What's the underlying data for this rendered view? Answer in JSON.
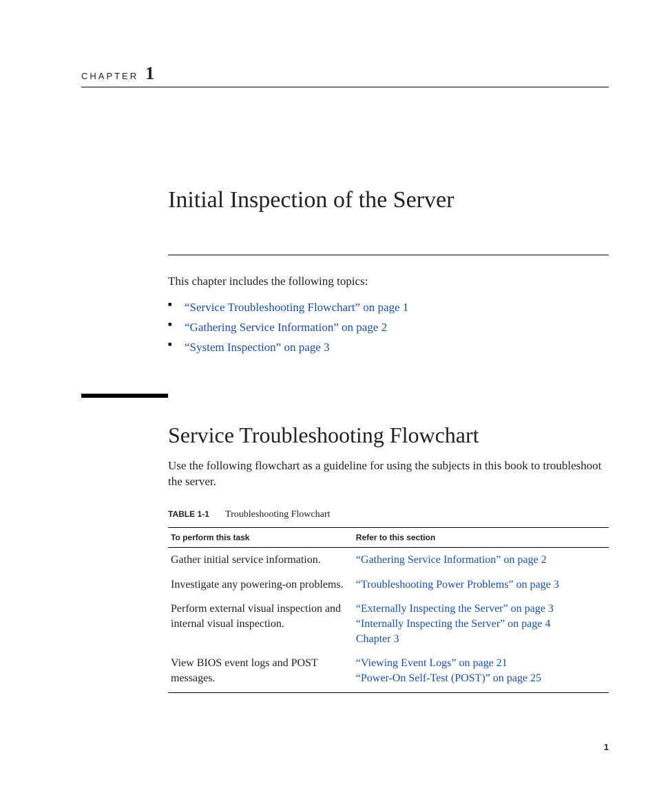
{
  "chapter": {
    "label": "CHAPTER",
    "number": "1"
  },
  "title": "Initial Inspection of the Server",
  "intro": "This chapter includes the following topics:",
  "toc": [
    "“Service Troubleshooting Flowchart” on page 1",
    "“Gathering Service Information” on page 2",
    "“System Inspection” on page 3"
  ],
  "section": {
    "title": "Service Troubleshooting Flowchart",
    "body": "Use the following flowchart as a guideline for using the subjects in this book to troubleshoot the server."
  },
  "table": {
    "caption_label": "TABLE 1-1",
    "caption_text": "Troubleshooting Flowchart",
    "headers": [
      "To perform this task",
      "Refer to this section"
    ],
    "rows": [
      {
        "task": "Gather initial service information.",
        "refs": [
          "“Gathering Service Information” on page 2"
        ]
      },
      {
        "task": "Investigate any powering-on problems.",
        "refs": [
          "“Troubleshooting Power Problems” on page 3"
        ]
      },
      {
        "task": "Perform external visual inspection and internal visual inspection.",
        "refs": [
          "“Externally Inspecting the Server” on page 3",
          "“Internally Inspecting the Server” on page 4",
          "Chapter 3"
        ]
      },
      {
        "task": "View BIOS event logs and POST messages.",
        "refs": [
          "“Viewing Event Logs” on page 21",
          "“Power-On Self-Test (POST)” on page 25"
        ]
      }
    ]
  },
  "page_number": "1"
}
